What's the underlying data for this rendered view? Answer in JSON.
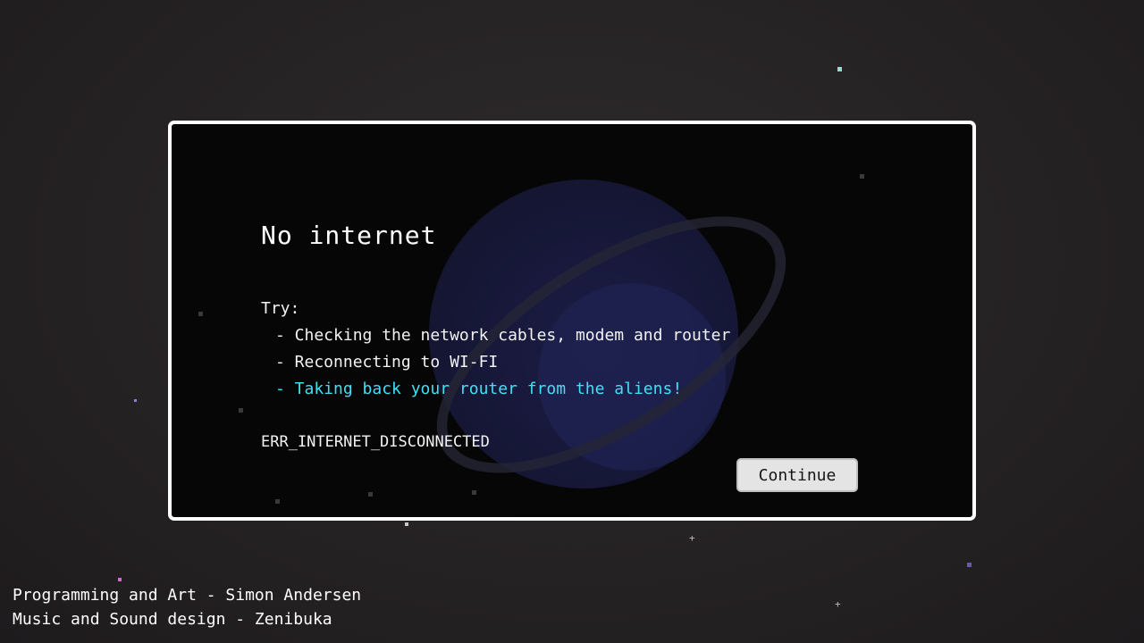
{
  "dialog": {
    "title": "No internet",
    "try_label": "Try:",
    "tips": [
      "- Checking the network cables, modem and router",
      "- Reconnecting to WI-FI",
      "- Taking back your router from the aliens!"
    ],
    "error_code": "ERR_INTERNET_DISCONNECTED",
    "continue_label": "Continue"
  },
  "credits": {
    "line1": "Programming and Art - Simon Andersen",
    "line2": "Music and Sound design - Zenibuka"
  },
  "colors": {
    "background": "#272425",
    "dialog_bg": "#060606",
    "dialog_border": "#ffffff",
    "highlight_tip": "#3fe0f5",
    "button_bg": "#e4e4e4"
  },
  "icons": [
    "planet-graphic",
    "star-icon",
    "sparkle-icon"
  ]
}
